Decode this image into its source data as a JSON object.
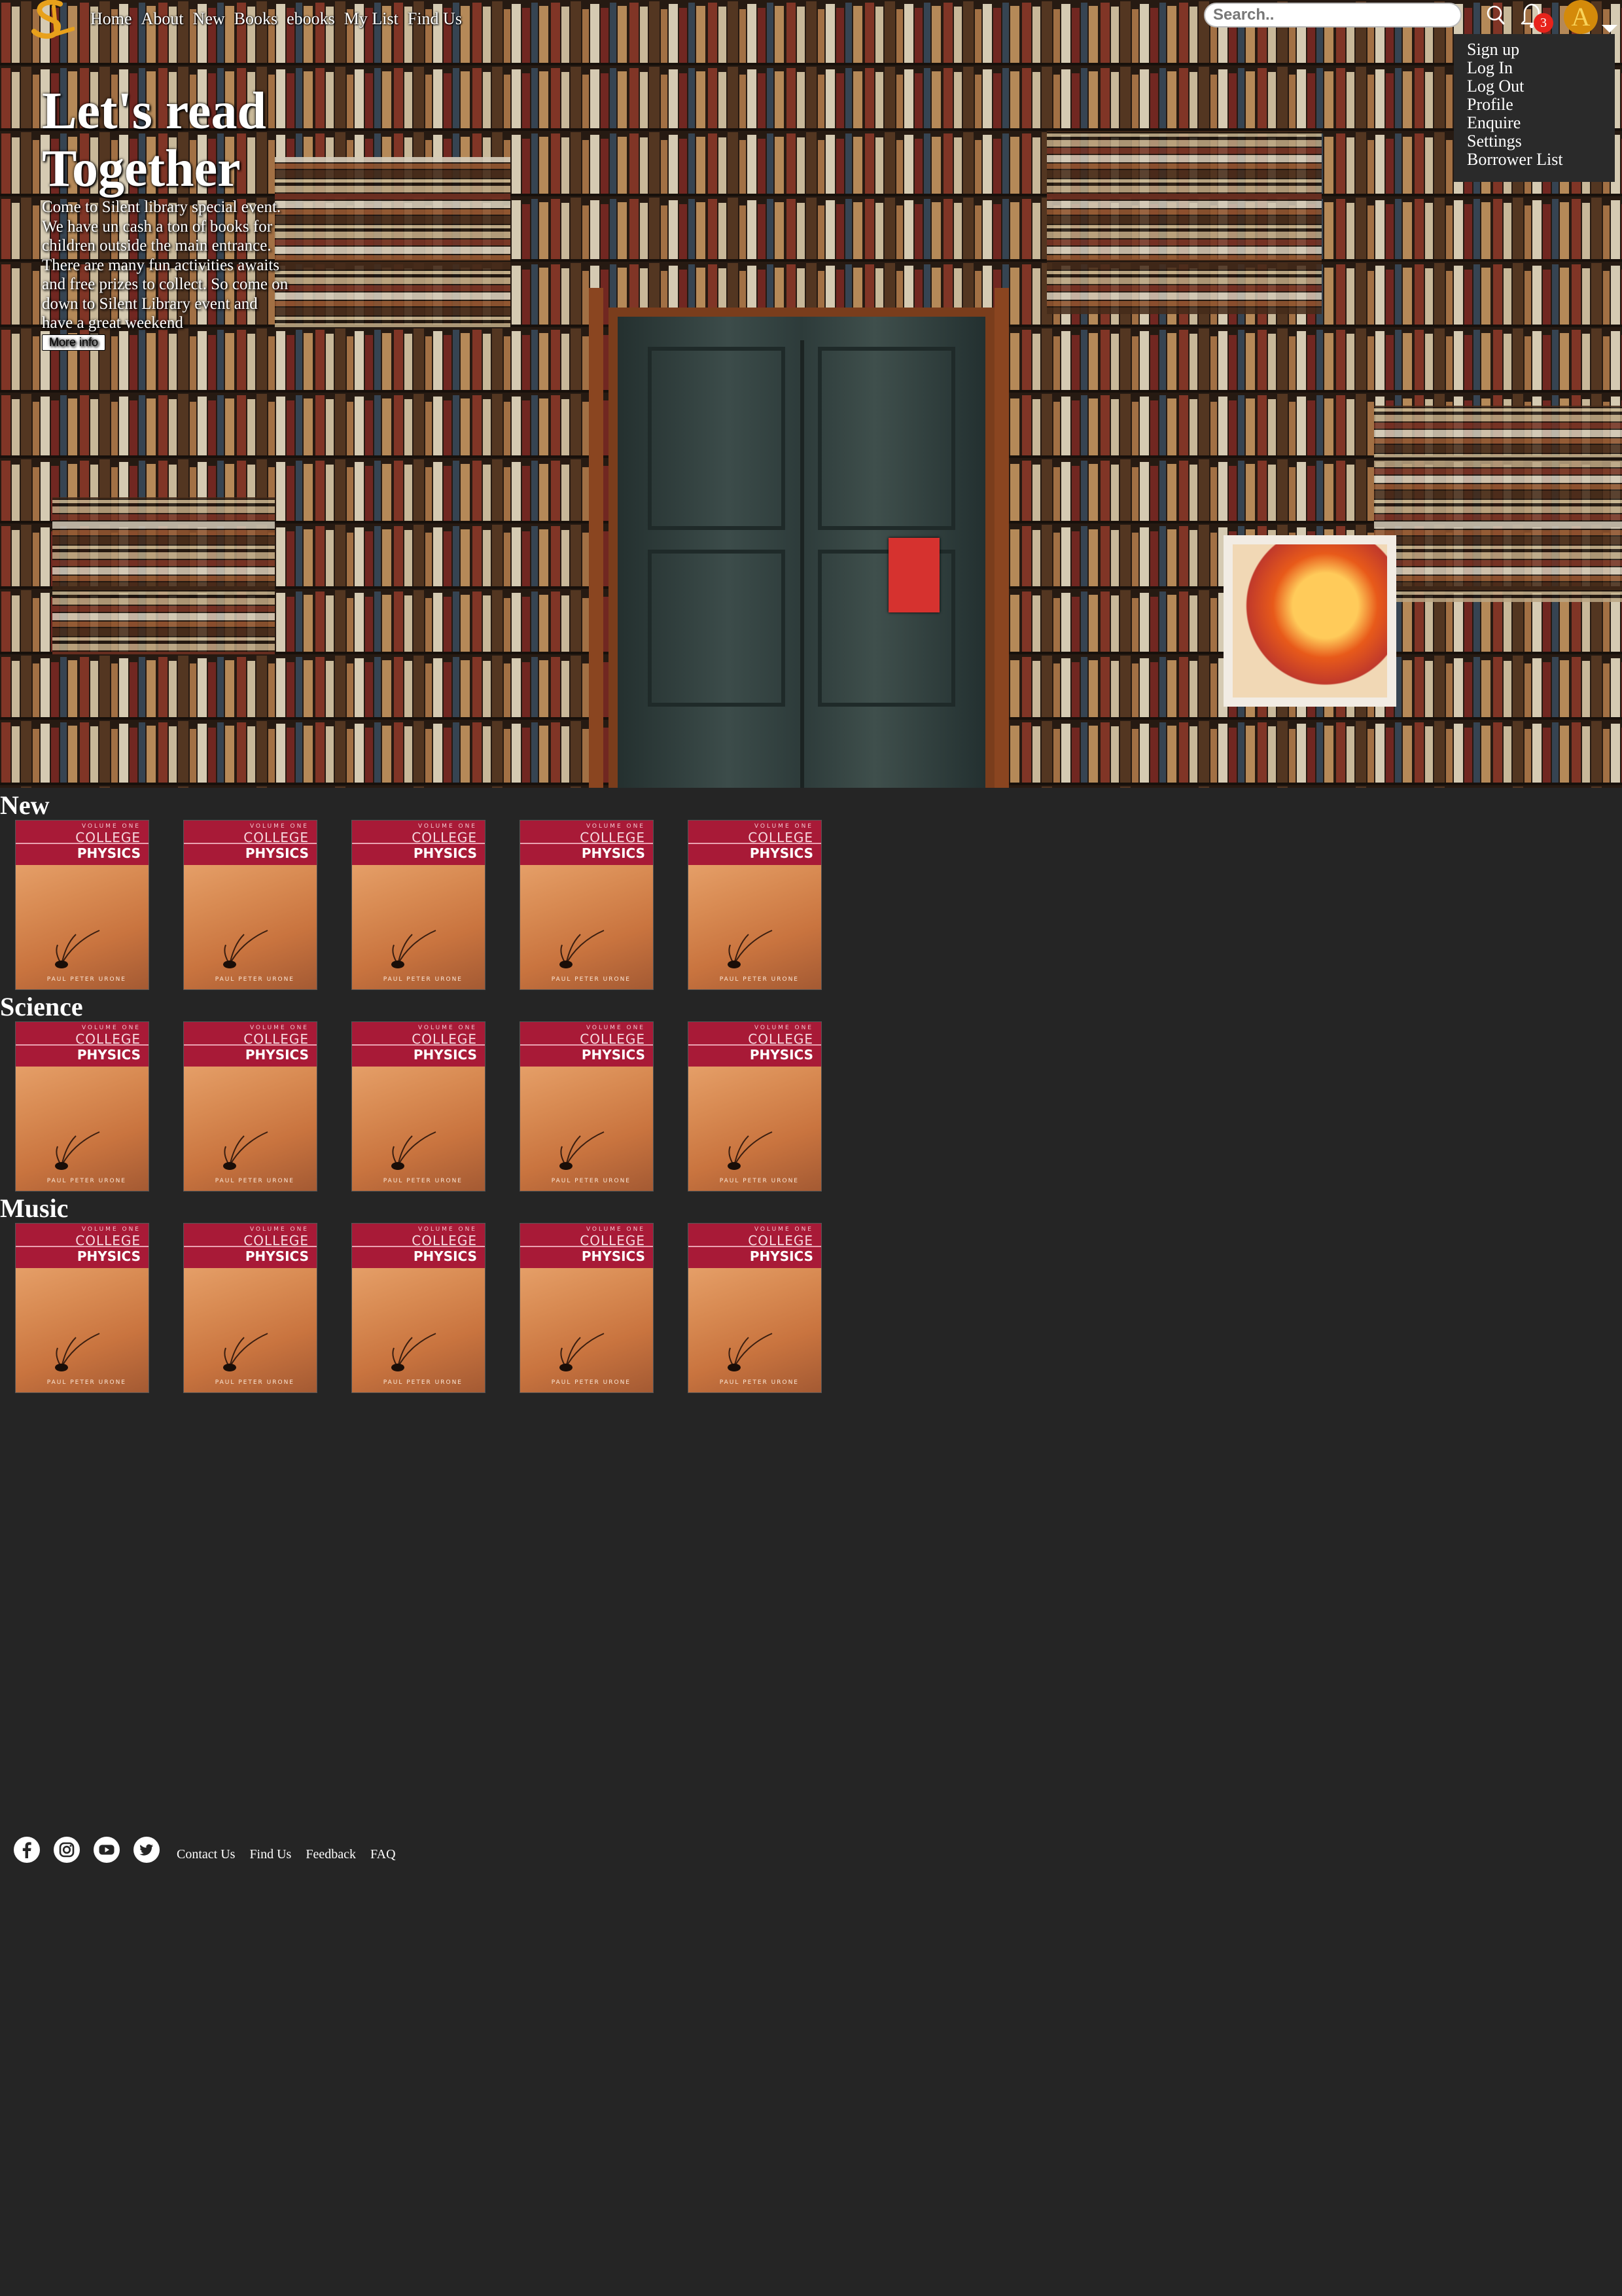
{
  "nav": {
    "links": [
      "Home",
      "About",
      "New",
      "Books",
      "ebooks",
      "My List",
      "Find Us"
    ]
  },
  "search": {
    "placeholder": "Search.."
  },
  "notifications": {
    "count": "3"
  },
  "avatar": {
    "letter": "A"
  },
  "dropdown": {
    "items": [
      "Sign up",
      "Log In",
      "Log Out",
      "Profile",
      "Enquire",
      "Settings",
      "Borrower List"
    ]
  },
  "hero": {
    "title": "Let's read Together",
    "description": "Come to Silent library special event. We have un cash a ton of books for children outside the main entrance. There are many fun activities awaits and free prizes to collect. So come on down to Silent Library event and have a great weekend",
    "button": "More info"
  },
  "sections": [
    {
      "title": "New"
    },
    {
      "title": "Science"
    },
    {
      "title": "Music"
    }
  ],
  "book": {
    "volume": "VOLUME ONE",
    "title_line1": "COLLEGE",
    "title_line2": "PHYSICS",
    "author": "PAUL PETER URONE"
  },
  "footer": {
    "links": [
      "Contact Us",
      "Find Us",
      "Feedback",
      "FAQ"
    ],
    "social_icons": [
      "facebook-icon",
      "instagram-icon",
      "youtube-icon",
      "twitter-icon"
    ]
  },
  "colors": {
    "background": "#252525",
    "accent": "#d48a0a",
    "badge": "#e8231b",
    "book_band": "#a81a37"
  }
}
